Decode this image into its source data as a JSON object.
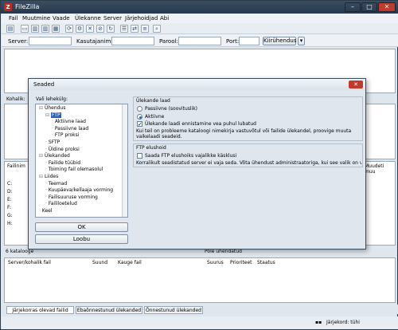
{
  "window": {
    "title": "FileZilla"
  },
  "menu": [
    "Fail",
    "Muutmine",
    "Vaade",
    "Ülekanne",
    "Server",
    "Järjehoidjad",
    "Abi"
  ],
  "quickconnect": {
    "server_label": "Server:",
    "user_label": "Kasutajanimi:",
    "pass_label": "Parool:",
    "port_label": "Port:",
    "button": "Kiirühendus"
  },
  "local": {
    "label": "Kohalik:",
    "files_header": "Failinim",
    "drives": [
      "C:",
      "D:",
      "E:",
      "F:",
      "G:",
      "H:"
    ],
    "status": "6 katalooge"
  },
  "remote": {
    "files_header": "Muudeti muu",
    "status": "Pole ühendatud"
  },
  "queue": {
    "columns": [
      "Server/kohalik fail",
      "Suund",
      "Kauge fail",
      "Suurus",
      "Prioriteet",
      "Staatus"
    ]
  },
  "bottom_tabs": [
    "Järjekorras olevad failid",
    "Ebaõnnestunud ülekanded",
    "Õnnestunud ülekanded"
  ],
  "statusbar": {
    "queue": "Järjekord: tühi"
  },
  "dialog": {
    "title": "Seaded",
    "select_page_label": "Vali lehekülg:",
    "tree": [
      {
        "label": "Ühendus",
        "level": 0
      },
      {
        "label": "FTP",
        "level": 1,
        "selected": true
      },
      {
        "label": "Aktiivne laad",
        "level": 2
      },
      {
        "label": "Passiivne laad",
        "level": 2
      },
      {
        "label": "FTP proksi",
        "level": 2
      },
      {
        "label": "SFTP",
        "level": 1
      },
      {
        "label": "Üldine proksi",
        "level": 1
      },
      {
        "label": "Ülekanded",
        "level": 0
      },
      {
        "label": "Failide tüübid",
        "level": 1
      },
      {
        "label": "Toiming fail olemasolul",
        "level": 1
      },
      {
        "label": "Liides",
        "level": 0
      },
      {
        "label": "Teemad",
        "level": 1
      },
      {
        "label": "Kuupäeva/kellaaja vorming",
        "level": 1
      },
      {
        "label": "Failisuuruse vorming",
        "level": 1
      },
      {
        "label": "Faililoetelud",
        "level": 1
      },
      {
        "label": "Keel",
        "level": 0
      }
    ],
    "ok": "OK",
    "cancel": "Loobu",
    "transfer_mode": {
      "heading": "Ülekande laad",
      "passive": "Passiivne (soovituslik)",
      "active": "Aktiivne",
      "fallback": "Ülekande laadi ennistamine vea puhul lubatud",
      "hint": "Kui teil on probleeme kataloogi nimekirja vastuvõtul või failide ülekandel, proovige muuta vaikelaadi seadeid."
    },
    "keepalive": {
      "heading": "FTP elushoid",
      "checkbox": "Saada FTP elushoiks vajalikke käsklusi",
      "hint": "Korralikult seadistatud server ei vaja seda. Võta ühendust administraatoriga, kui see valik on vajalik."
    }
  },
  "colors": {
    "accent": "#2a62b5",
    "titlebar": "#2d3e52",
    "logo": "#c4281c"
  }
}
